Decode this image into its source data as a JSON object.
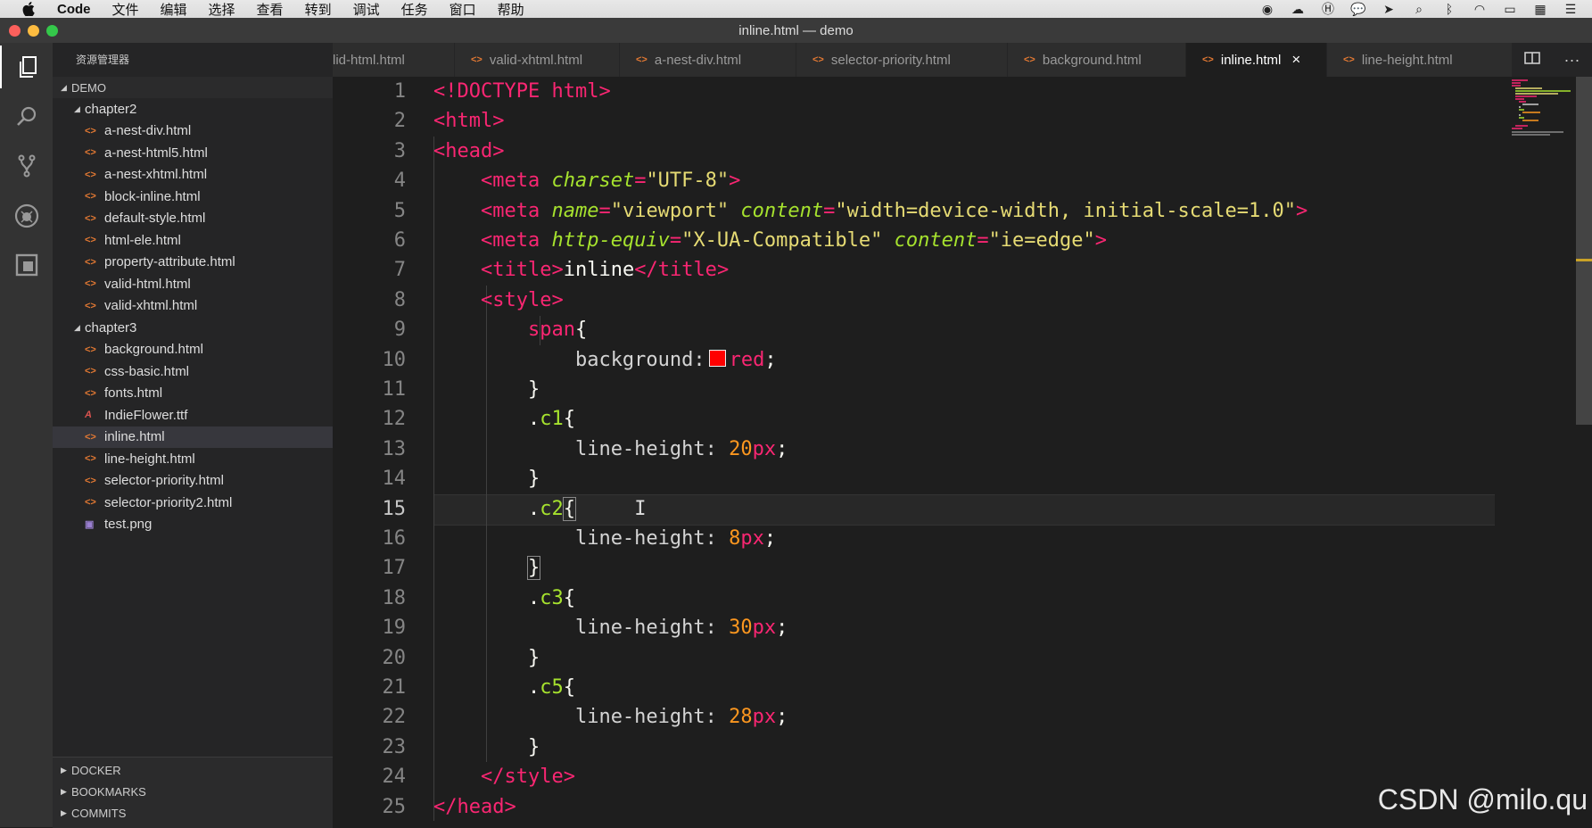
{
  "menubar": {
    "app_name": "Code",
    "menus": [
      "文件",
      "编辑",
      "选择",
      "查看",
      "转到",
      "调试",
      "任务",
      "窗口",
      "帮助"
    ]
  },
  "window": {
    "title": "inline.html — demo"
  },
  "sidebar": {
    "title": "资源管理器",
    "root": "DEMO",
    "tree": [
      {
        "label": "chapter2",
        "type": "folder"
      },
      {
        "label": "a-nest-div.html",
        "type": "html"
      },
      {
        "label": "a-nest-html5.html",
        "type": "html"
      },
      {
        "label": "a-nest-xhtml.html",
        "type": "html"
      },
      {
        "label": "block-inline.html",
        "type": "html"
      },
      {
        "label": "default-style.html",
        "type": "html"
      },
      {
        "label": "html-ele.html",
        "type": "html"
      },
      {
        "label": "property-attribute.html",
        "type": "html"
      },
      {
        "label": "valid-html.html",
        "type": "html"
      },
      {
        "label": "valid-xhtml.html",
        "type": "html"
      },
      {
        "label": "chapter3",
        "type": "folder"
      },
      {
        "label": "background.html",
        "type": "html"
      },
      {
        "label": "css-basic.html",
        "type": "html"
      },
      {
        "label": "fonts.html",
        "type": "html"
      },
      {
        "label": "IndieFlower.ttf",
        "type": "font"
      },
      {
        "label": "inline.html",
        "type": "html",
        "active": true
      },
      {
        "label": "line-height.html",
        "type": "html"
      },
      {
        "label": "selector-priority.html",
        "type": "html"
      },
      {
        "label": "selector-priority2.html",
        "type": "html"
      },
      {
        "label": "test.png",
        "type": "image"
      }
    ],
    "sections": [
      "DOCKER",
      "BOOKMARKS",
      "COMMITS"
    ]
  },
  "tabs": [
    {
      "label": "lid-html.html"
    },
    {
      "label": "valid-xhtml.html"
    },
    {
      "label": "a-nest-div.html"
    },
    {
      "label": "selector-priority.html"
    },
    {
      "label": "background.html"
    },
    {
      "label": "inline.html",
      "active": true
    },
    {
      "label": "line-height.html"
    }
  ],
  "editor": {
    "line_numbers": [
      "1",
      "2",
      "3",
      "4",
      "5",
      "6",
      "7",
      "8",
      "9",
      "10",
      "11",
      "12",
      "13",
      "14",
      "15",
      "16",
      "17",
      "18",
      "19",
      "20",
      "21",
      "22",
      "23",
      "24",
      "25"
    ],
    "current_line": "15"
  },
  "watermark": "CSDN @milo.qu",
  "colors": {
    "tag": "#f92672",
    "attribute": "#a6e22e",
    "string": "#e6db74",
    "number": "#fd971f",
    "swatch_red": "#ff0000"
  }
}
